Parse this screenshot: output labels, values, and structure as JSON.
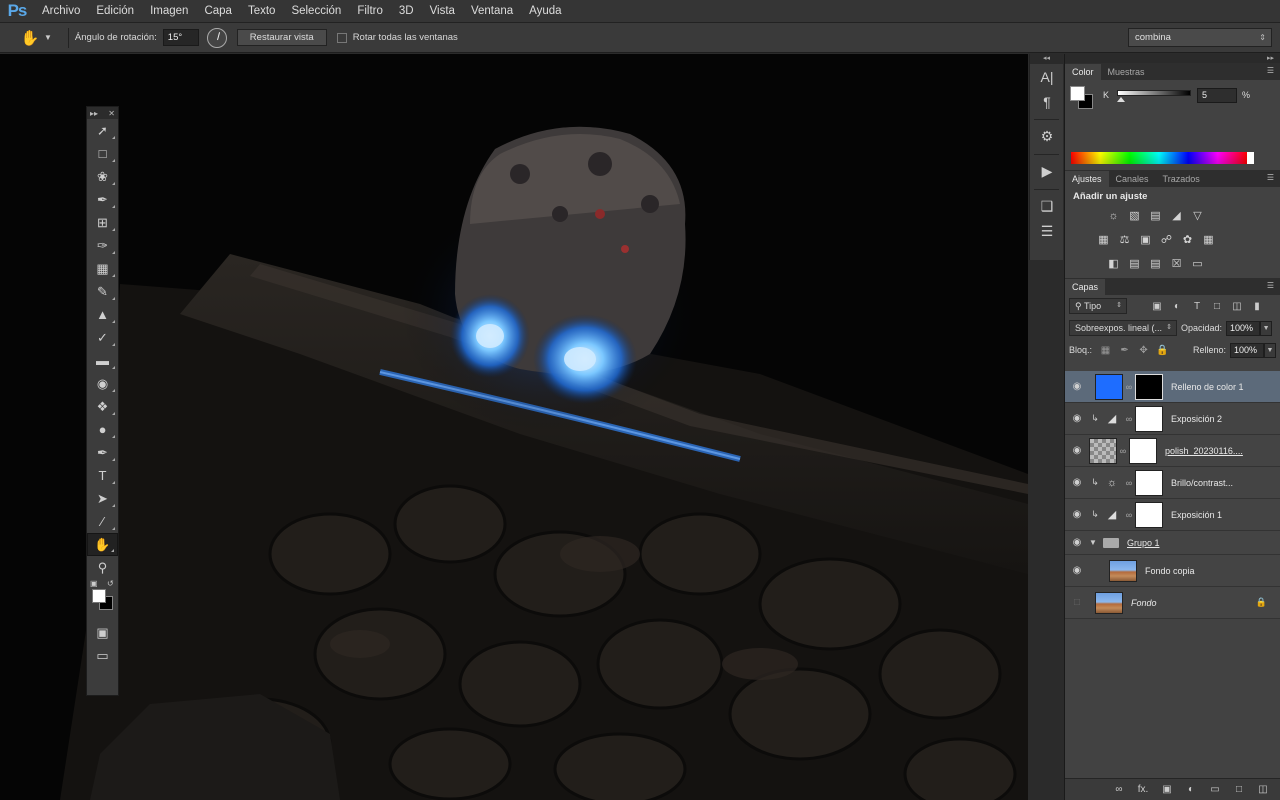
{
  "app_logo": "Ps",
  "menu": [
    "Archivo",
    "Edición",
    "Imagen",
    "Capa",
    "Texto",
    "Selección",
    "Filtro",
    "3D",
    "Vista",
    "Ventana",
    "Ayuda"
  ],
  "options": {
    "tool_icon": "rotate-view-icon",
    "rotation_label": "Ángulo de rotación:",
    "rotation_value": "15°",
    "reset_label": "Restaurar vista",
    "rotate_all_label": "Rotar todas las ventanas",
    "workspace_value": "combina"
  },
  "color_panel": {
    "tabs": [
      "Color",
      "Muestras"
    ],
    "channel_label": "K",
    "channel_value": "5",
    "channel_unit": "%"
  },
  "adjustments_panel": {
    "tabs": [
      "Ajustes",
      "Canales",
      "Trazados"
    ],
    "title": "Añadir un ajuste"
  },
  "layers_panel": {
    "tab": "Capas",
    "filter_label": "Tipo",
    "blend_mode": "Sobreexpos. lineal (...",
    "opacity_label": "Opacidad:",
    "opacity_value": "100%",
    "lock_label": "Bloq.:",
    "fill_label": "Relleno:",
    "fill_value": "100%",
    "layers": [
      {
        "name": "Relleno de color 1",
        "selected": true
      },
      {
        "name": "Exposición 2"
      },
      {
        "name": "polish_20230116...."
      },
      {
        "name": "Brillo/contrast..."
      },
      {
        "name": "Exposición 1"
      },
      {
        "name": "Grupo 1"
      },
      {
        "name": "Fondo copia"
      },
      {
        "name": "Fondo"
      }
    ]
  },
  "colors": {
    "accent": "#5aa8e8",
    "fill_color": "#1e6dff",
    "selected_layer": "#5c6a7a"
  }
}
